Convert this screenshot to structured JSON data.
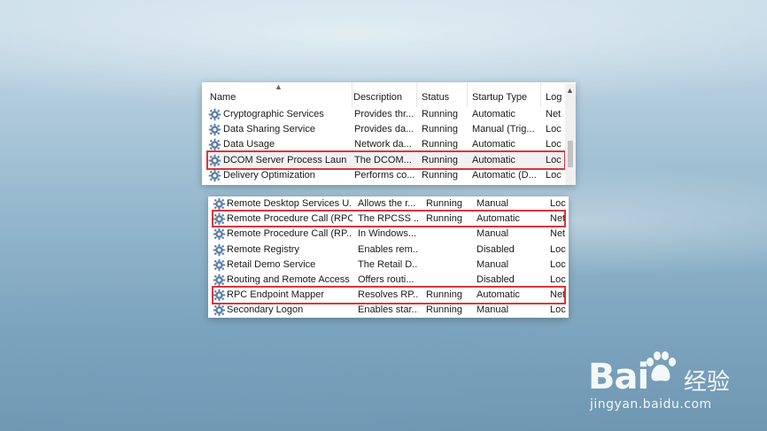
{
  "top_table": {
    "columns": [
      "Name",
      "Description",
      "Status",
      "Startup Type",
      "Log"
    ],
    "rows": [
      {
        "name": "Cryptographic Services",
        "description": "Provides thr...",
        "status": "Running",
        "startup": "Automatic",
        "log": "Net"
      },
      {
        "name": "Data Sharing Service",
        "description": "Provides da...",
        "status": "Running",
        "startup": "Manual (Trig...",
        "log": "Loc"
      },
      {
        "name": "Data Usage",
        "description": "Network da...",
        "status": "Running",
        "startup": "Automatic",
        "log": "Loc"
      },
      {
        "name": "DCOM Server Process Laun...",
        "description": "The DCOM...",
        "status": "Running",
        "startup": "Automatic",
        "log": "Loc"
      },
      {
        "name": "Delivery Optimization",
        "description": "Performs co...",
        "status": "Running",
        "startup": "Automatic (D...",
        "log": "Loc"
      }
    ]
  },
  "bottom_table": {
    "rows": [
      {
        "name": "Remote Desktop Services U...",
        "description": "Allows the r...",
        "status": "Running",
        "startup": "Manual",
        "log": "Loc"
      },
      {
        "name": "Remote Procedure Call (RPC)",
        "description": "The RPCSS ...",
        "status": "Running",
        "startup": "Automatic",
        "log": "Net"
      },
      {
        "name": "Remote Procedure Call (RP...",
        "description": "In Windows...",
        "status": "",
        "startup": "Manual",
        "log": "Net"
      },
      {
        "name": "Remote Registry",
        "description": "Enables rem...",
        "status": "",
        "startup": "Disabled",
        "log": "Loc"
      },
      {
        "name": "Retail Demo Service",
        "description": "The Retail D...",
        "status": "",
        "startup": "Manual",
        "log": "Loc"
      },
      {
        "name": "Routing and Remote Access",
        "description": "Offers routi...",
        "status": "",
        "startup": "Disabled",
        "log": "Loc"
      },
      {
        "name": "RPC Endpoint Mapper",
        "description": "Resolves RP...",
        "status": "Running",
        "startup": "Automatic",
        "log": "Net"
      },
      {
        "name": "Secondary Logon",
        "description": "Enables star...",
        "status": "Running",
        "startup": "Manual",
        "log": "Loc"
      }
    ]
  },
  "watermark": {
    "brand": "Bai",
    "brand_suffix": "经验",
    "url": "jingyan.baidu.com"
  },
  "colors": {
    "highlight": "#d9363e",
    "gear": "#5b7fa6"
  }
}
